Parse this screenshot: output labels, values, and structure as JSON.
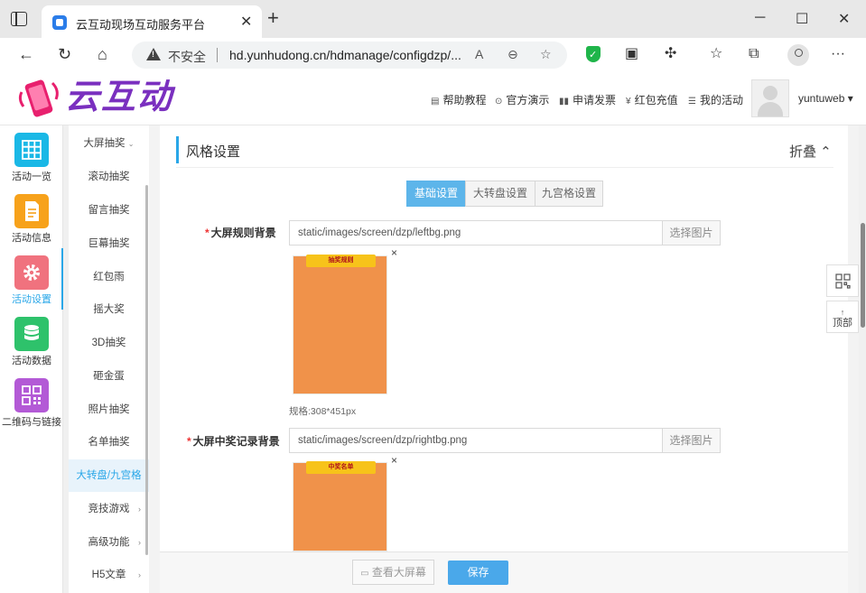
{
  "browser": {
    "tab_title": "云互动现场互动服务平台",
    "tab_close": "✕",
    "new_tab": "+",
    "window_minimize": "─",
    "window_maximize": "☐",
    "window_close": "✕",
    "insecure_label": "不安全",
    "url": "hd.yunhudong.cn/hdmanage/configdzp/...",
    "read_aloud": "A",
    "zoom": "⊖",
    "favorite_add": "☆",
    "more": "···"
  },
  "header": {
    "logo_text": "云互动",
    "nav": [
      {
        "icon": "▤",
        "label": "帮助教程"
      },
      {
        "icon": "⊙",
        "label": "官方演示"
      },
      {
        "icon": "▮▮",
        "label": "申请发票"
      },
      {
        "icon": "¥",
        "label": "红包充值"
      },
      {
        "icon": "☰",
        "label": "我的活动"
      }
    ],
    "username": "yuntuweb ▾"
  },
  "sidebar": {
    "items": [
      {
        "label": "活动一览",
        "color": "#1ab8e6"
      },
      {
        "label": "活动信息",
        "color": "#f7a21b"
      },
      {
        "label": "活动设置",
        "color": "#f0727e"
      },
      {
        "label": "活动数据",
        "color": "#2ec26b"
      },
      {
        "label": "二维码与链接",
        "color": "#b35ad6"
      }
    ]
  },
  "submenu": {
    "items": [
      {
        "label": "大屏抽奖",
        "arrow": "⌄"
      },
      {
        "label": "滚动抽奖",
        "arrow": ""
      },
      {
        "label": "留言抽奖",
        "arrow": ""
      },
      {
        "label": "巨幕抽奖",
        "arrow": ""
      },
      {
        "label": "红包雨",
        "arrow": ""
      },
      {
        "label": "摇大奖",
        "arrow": ""
      },
      {
        "label": "3D抽奖",
        "arrow": ""
      },
      {
        "label": "砸金蛋",
        "arrow": ""
      },
      {
        "label": "照片抽奖",
        "arrow": ""
      },
      {
        "label": "名单抽奖",
        "arrow": ""
      },
      {
        "label": "大转盘/九宫格",
        "arrow": ""
      },
      {
        "label": "竞技游戏",
        "arrow": "›"
      },
      {
        "label": "高级功能",
        "arrow": "›"
      },
      {
        "label": "H5文章",
        "arrow": "›"
      }
    ]
  },
  "panel": {
    "title": "风格设置",
    "collapse": "折叠 ⌃",
    "tabs": [
      "基础设置",
      "大转盘设置",
      "九宫格设置"
    ],
    "fields": [
      {
        "required": "*",
        "label": "大屏规则背景",
        "value": "static/images/screen/dzp/leftbg.png",
        "button": "选择图片",
        "ribbon": "抽奖规则",
        "remove": "×",
        "spec": "规格:308*451px"
      },
      {
        "required": "*",
        "label": "大屏中奖记录背景",
        "value": "static/images/screen/dzp/rightbg.png",
        "button": "选择图片",
        "ribbon": "中奖名单",
        "remove": "×"
      }
    ]
  },
  "footer": {
    "preview": "查看大屏幕",
    "save": "保存"
  },
  "float_tools": {
    "top_arrow": "↑",
    "top_label": "顶部"
  }
}
